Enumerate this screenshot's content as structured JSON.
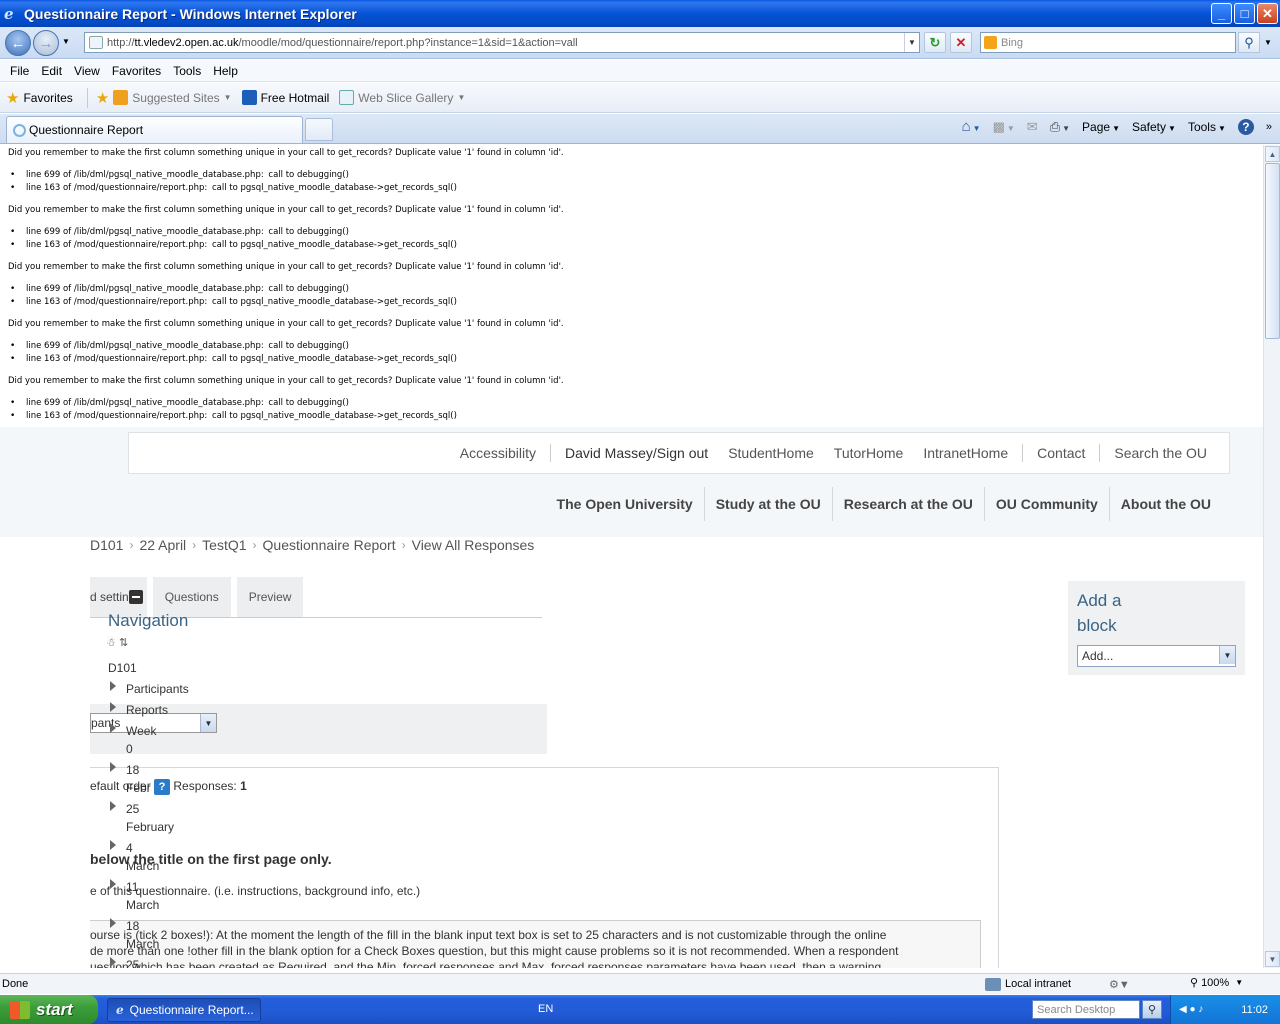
{
  "window": {
    "title": "Questionnaire Report - Windows Internet Explorer",
    "controls": [
      "_",
      "□",
      "✕"
    ]
  },
  "address": {
    "url_prefix": "http://",
    "url_host": "tt.vledev2.open.ac.uk",
    "url_path": "/moodle/mod/questionnaire/report.php?instance=1&sid=1&action=vall",
    "search_placeholder": "Bing"
  },
  "menu": [
    "File",
    "Edit",
    "View",
    "Favorites",
    "Tools",
    "Help"
  ],
  "favorites_bar": {
    "favorites": "Favorites",
    "suggested": "Suggested Sites",
    "hotmail": "Free Hotmail",
    "webslice": "Web Slice Gallery"
  },
  "tab": {
    "title": "Questionnaire Report"
  },
  "command_bar": {
    "page": "Page",
    "safety": "Safety",
    "tools": "Tools"
  },
  "debug": {
    "message": "Did you remember to make the first column something unique in your call to get_records? Duplicate value '1' found in column 'id'.",
    "line1_loc": "line 699 of /lib/dml/pgsql_native_moodle_database.php:",
    "line1_call": "call to debugging()",
    "line2_loc": "line 163 of /mod/questionnaire/report.php:",
    "line2_call": "call to pgsql_native_moodle_database->get_records_sql()"
  },
  "util_nav": {
    "accessibility": "Accessibility",
    "user": "David Massey/Sign out",
    "student_home": "StudentHome",
    "tutor_home": "TutorHome",
    "intranet_home": "IntranetHome",
    "contact": "Contact",
    "search": "Search the OU"
  },
  "main_nav": {
    "ou": "The Open University",
    "study": "Study at the OU",
    "research": "Research at the OU",
    "community": "OU Community",
    "about": "About the OU"
  },
  "breadcrumb": [
    "D101",
    "22 April",
    "TestQ1",
    "Questionnaire Report",
    "View All Responses"
  ],
  "tabs": {
    "settings": "d settin",
    "questions": "Questions",
    "preview": "Preview"
  },
  "navigation": {
    "title": "Navigation",
    "course": "D101",
    "participants": "Participants",
    "reports": "Reports",
    "week0_a": "Week",
    "week0_b": "0",
    "w18_a": "18",
    "w18_b": "Febr",
    "w25_a": "25",
    "w25_b": "February",
    "w4_a": "4",
    "w4_b": "March",
    "w11_a": "11",
    "w11_b": "March",
    "w18m_a": "18",
    "w18m_b": "March",
    "w25m_a": "25"
  },
  "filter": {
    "select_value": "pants"
  },
  "responses": {
    "prefix": "efault order",
    "label": "Responses:",
    "count": "1"
  },
  "question": {
    "heading": "below the title on the first page only.",
    "instructions": "e of this questionnaire. (i.e. instructions, background info, etc.)",
    "desc_line1": "ourse is (tick 2 boxes!): At the moment the length of the fill in the blank input text box is set to 25 characters and is not customizable through the online",
    "desc_line2": "de more than one !other fill in the blank option for a Check Boxes question, but this might cause problems so it is not recommended. When a respondent",
    "desc_line3": "uestion which has been created as Required, and the Min. forced responses and Max. forced responses parameters have been used, then a warning"
  },
  "add_block": {
    "title": "Add a block",
    "select_value": "Add..."
  },
  "status": {
    "left": "Done",
    "zone": "Local intranet",
    "zoom": "100%"
  },
  "taskbar": {
    "start": "start",
    "task": "Questionnaire Report...",
    "lang": "EN",
    "search_placeholder": "Search Desktop",
    "clock": "11:02"
  }
}
